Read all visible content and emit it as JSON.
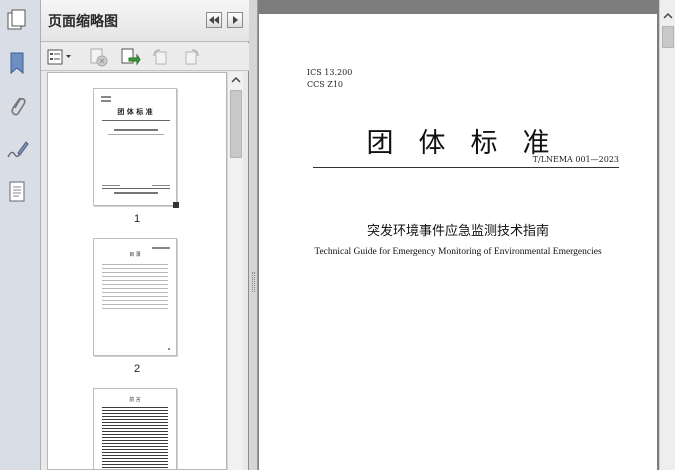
{
  "panel": {
    "title": "页面缩略图"
  },
  "thumbnails": [
    {
      "page": "1",
      "mini_title": "团  体  标  准"
    },
    {
      "page": "2",
      "mini_title": "目  录"
    },
    {
      "page": "",
      "mini_title": "前  言"
    }
  ],
  "document": {
    "ics_line": "ICS  13.200",
    "ccs_line": "CCS  Z10",
    "main_title": "团体标准",
    "standard_number": "T/LNEMA 001—2023",
    "title_cn": "突发环境事件应急监测技术指南",
    "title_en": "Technical Guide for Emergency Monitoring of Environmental Emergencies"
  }
}
